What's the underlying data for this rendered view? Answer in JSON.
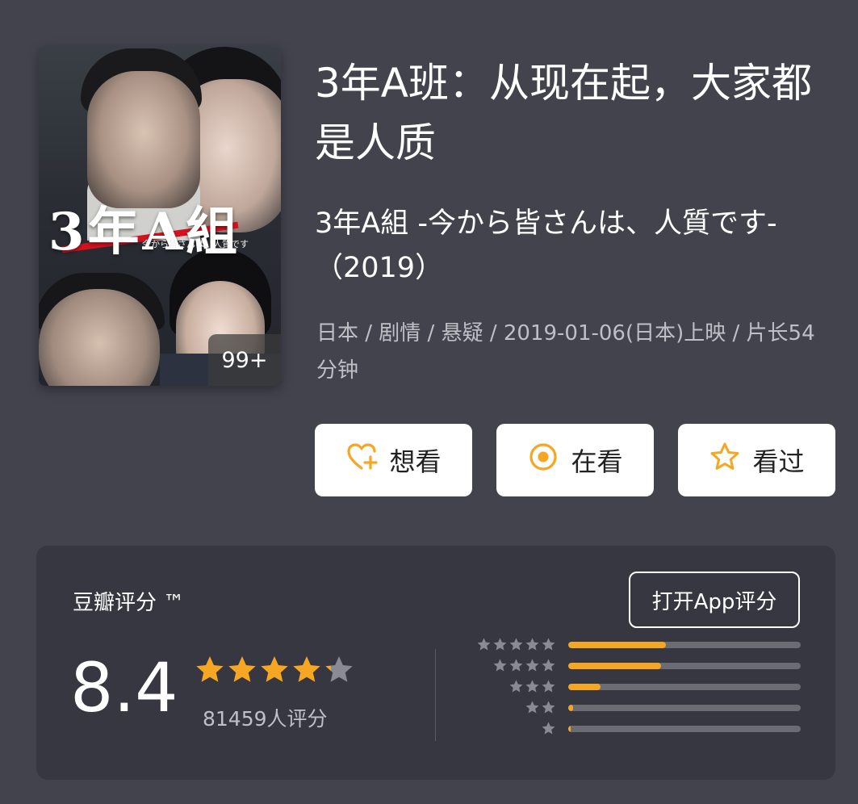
{
  "movie": {
    "title": "3年A班：从现在起，大家都是人质",
    "original_title": "3年A組 -今から皆さんは、人質です-（2019）",
    "meta": "日本 / 剧情 / 悬疑 / 2019-01-06(日本)上映 / 片长54分钟",
    "poster": {
      "title_text": "3年A組",
      "subtitle_text": "今から皆さんは、人質です",
      "badge": "99+"
    }
  },
  "actions": {
    "want": "想看",
    "watching": "在看",
    "watched": "看过"
  },
  "rating": {
    "title": "豆瓣评分 ™",
    "open_app": "打开App评分",
    "score": "8.4",
    "stars": 4.2,
    "count": "81459人评分",
    "distribution": [
      {
        "stars": 5,
        "fraction": 0.42
      },
      {
        "stars": 4,
        "fraction": 0.4
      },
      {
        "stars": 3,
        "fraction": 0.14
      },
      {
        "stars": 2,
        "fraction": 0.02
      },
      {
        "stars": 1,
        "fraction": 0.005
      }
    ]
  },
  "colors": {
    "background": "#43434e",
    "card": "#373741",
    "accent": "#f5a623",
    "star_empty": "#8a8a92"
  }
}
